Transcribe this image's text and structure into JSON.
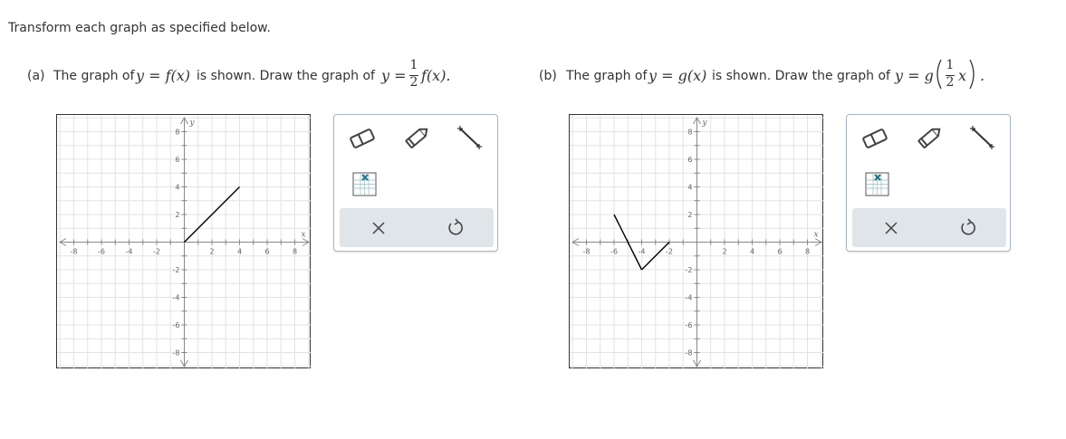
{
  "instructions": "Transform each graph as specified below.",
  "parts": [
    {
      "label": "(a)",
      "prompt_before": "The graph of",
      "given_function": "y = f(x)",
      "prompt_middle": "is shown. Draw the graph of",
      "target_lhs": "y =",
      "coef_num": "1",
      "coef_den": "2",
      "target_rest": "f(x).",
      "graph": {
        "x_label": "x",
        "y_label": "y",
        "x_ticks": [
          "-8",
          "-6",
          "-4",
          "-2",
          "2",
          "4",
          "6",
          "8"
        ],
        "y_ticks": [
          "8",
          "6",
          "4",
          "2",
          "-2",
          "-4",
          "-6",
          "-8"
        ],
        "segments": [
          [
            [
              0,
              0
            ],
            [
              4,
              4
            ]
          ]
        ]
      }
    },
    {
      "label": "(b)",
      "prompt_before": "The graph of",
      "given_function": "y = g(x)",
      "prompt_middle": "is shown. Draw the graph of",
      "target_lhs": "y = g",
      "coef_num": "1",
      "coef_den": "2",
      "target_rest": "x",
      "target_tail": ".",
      "graph": {
        "x_label": "x",
        "y_label": "y",
        "x_ticks": [
          "-8",
          "-6",
          "-4",
          "-2",
          "2",
          "4",
          "6",
          "8"
        ],
        "y_ticks": [
          "8",
          "6",
          "4",
          "2",
          "-2",
          "-4",
          "-6",
          "-8"
        ],
        "segments": [
          [
            [
              -6,
              2
            ],
            [
              -4,
              -2
            ]
          ],
          [
            [
              -4,
              -2
            ],
            [
              -2,
              0
            ]
          ]
        ]
      }
    }
  ],
  "tools": [
    "eraser-icon",
    "pencil-icon",
    "line-segment-icon",
    "no-solution-icon"
  ],
  "actions": [
    "clear-icon",
    "undo-icon"
  ]
}
